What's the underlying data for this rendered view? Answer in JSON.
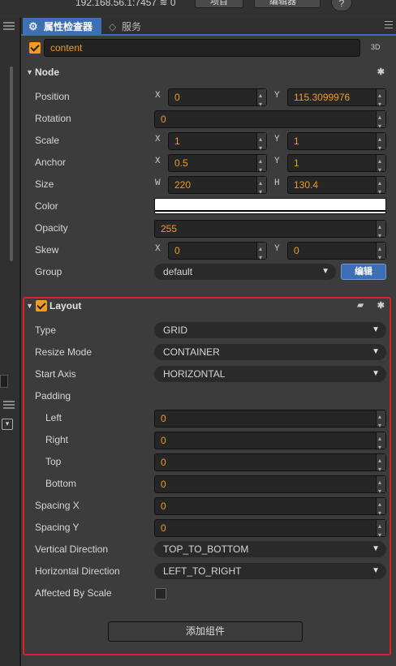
{
  "topbar": {
    "ip": "192.168.56.1:7457",
    "wifi_count": "0",
    "btn_project": "项目",
    "btn_editor": "编辑器",
    "help": "?"
  },
  "tabs": {
    "inspector": "属性检查器",
    "services": "服务"
  },
  "node": {
    "name": "content",
    "badge": "3D",
    "section_title": "Node"
  },
  "node_props": {
    "position": {
      "label": "Position",
      "x": "0",
      "y": "115.3099976"
    },
    "rotation": {
      "label": "Rotation",
      "value": "0"
    },
    "scale": {
      "label": "Scale",
      "x": "1",
      "y": "1"
    },
    "anchor": {
      "label": "Anchor",
      "x": "0.5",
      "y": "1"
    },
    "size": {
      "label": "Size",
      "w": "220",
      "h": "130.4"
    },
    "color": {
      "label": "Color",
      "value": "#FFFFFF"
    },
    "opacity": {
      "label": "Opacity",
      "value": "255"
    },
    "skew": {
      "label": "Skew",
      "x": "0",
      "y": "0"
    },
    "group": {
      "label": "Group",
      "value": "default",
      "edit": "编辑"
    }
  },
  "axis_labels": {
    "x": "X",
    "y": "Y",
    "w": "W",
    "h": "H"
  },
  "layout": {
    "title": "Layout",
    "type": {
      "label": "Type",
      "value": "GRID"
    },
    "resize_mode": {
      "label": "Resize Mode",
      "value": "CONTAINER"
    },
    "start_axis": {
      "label": "Start Axis",
      "value": "HORIZONTAL"
    },
    "padding": {
      "label": "Padding"
    },
    "left": {
      "label": "Left",
      "value": "0"
    },
    "right": {
      "label": "Right",
      "value": "0"
    },
    "top": {
      "label": "Top",
      "value": "0"
    },
    "bottom": {
      "label": "Bottom",
      "value": "0"
    },
    "spacing_x": {
      "label": "Spacing X",
      "value": "0"
    },
    "spacing_y": {
      "label": "Spacing Y",
      "value": "0"
    },
    "vertical_direction": {
      "label": "Vertical Direction",
      "value": "TOP_TO_BOTTOM"
    },
    "horizontal_direction": {
      "label": "Horizontal Direction",
      "value": "LEFT_TO_RIGHT"
    },
    "affected_by_scale": {
      "label": "Affected By Scale",
      "checked": false
    }
  },
  "add_component": "添加组件",
  "colors": {
    "accent": "#3d6eb6",
    "value_text": "#f29b1d",
    "highlight": "#e02020"
  }
}
